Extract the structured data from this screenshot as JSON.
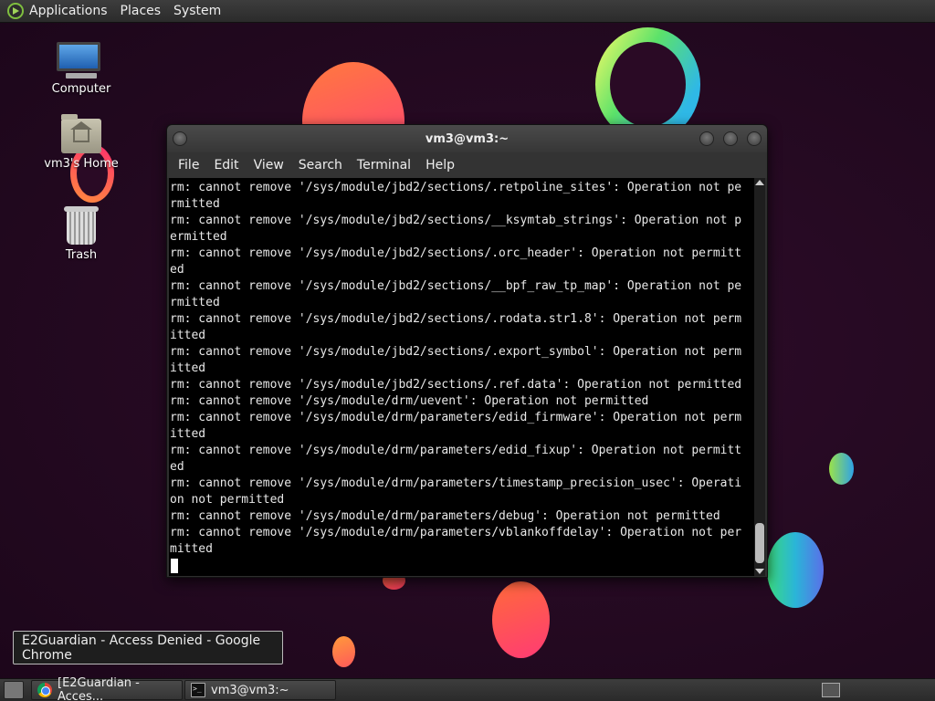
{
  "top_panel": {
    "menus": [
      "Applications",
      "Places",
      "System"
    ]
  },
  "desktop": {
    "icons": [
      {
        "label": "Computer",
        "icon": "computer-icon"
      },
      {
        "label": "vm3's Home",
        "icon": "home-folder-icon"
      },
      {
        "label": "Trash",
        "icon": "trash-icon"
      }
    ]
  },
  "terminal": {
    "title": "vm3@vm3:~",
    "menu": [
      "File",
      "Edit",
      "View",
      "Search",
      "Terminal",
      "Help"
    ],
    "lines": [
      "rm: cannot remove '/sys/module/jbd2/sections/.retpoline_sites': Operation not pe",
      "rmitted",
      "rm: cannot remove '/sys/module/jbd2/sections/__ksymtab_strings': Operation not p",
      "ermitted",
      "rm: cannot remove '/sys/module/jbd2/sections/.orc_header': Operation not permitt",
      "ed",
      "rm: cannot remove '/sys/module/jbd2/sections/__bpf_raw_tp_map': Operation not pe",
      "rmitted",
      "rm: cannot remove '/sys/module/jbd2/sections/.rodata.str1.8': Operation not perm",
      "itted",
      "rm: cannot remove '/sys/module/jbd2/sections/.export_symbol': Operation not perm",
      "itted",
      "rm: cannot remove '/sys/module/jbd2/sections/.ref.data': Operation not permitted",
      "rm: cannot remove '/sys/module/drm/uevent': Operation not permitted",
      "rm: cannot remove '/sys/module/drm/parameters/edid_firmware': Operation not perm",
      "itted",
      "rm: cannot remove '/sys/module/drm/parameters/edid_fixup': Operation not permitt",
      "ed",
      "rm: cannot remove '/sys/module/drm/parameters/timestamp_precision_usec': Operati",
      "on not permitted",
      "rm: cannot remove '/sys/module/drm/parameters/debug': Operation not permitted",
      "rm: cannot remove '/sys/module/drm/parameters/vblankoffdelay': Operation not per",
      "mitted"
    ]
  },
  "notification": {
    "text": "E2Guardian - Access Denied - Google Chrome"
  },
  "taskbar": {
    "tasks": [
      {
        "label": "[E2Guardian - Acces...",
        "icon": "chrome-icon"
      },
      {
        "label": "vm3@vm3:~",
        "icon": "terminal-icon"
      }
    ]
  },
  "colors": {
    "desktop_bg": "#2a0a25",
    "panel_bg": "#333333",
    "terminal_bg": "#000000",
    "terminal_fg": "#e8e8e8"
  }
}
